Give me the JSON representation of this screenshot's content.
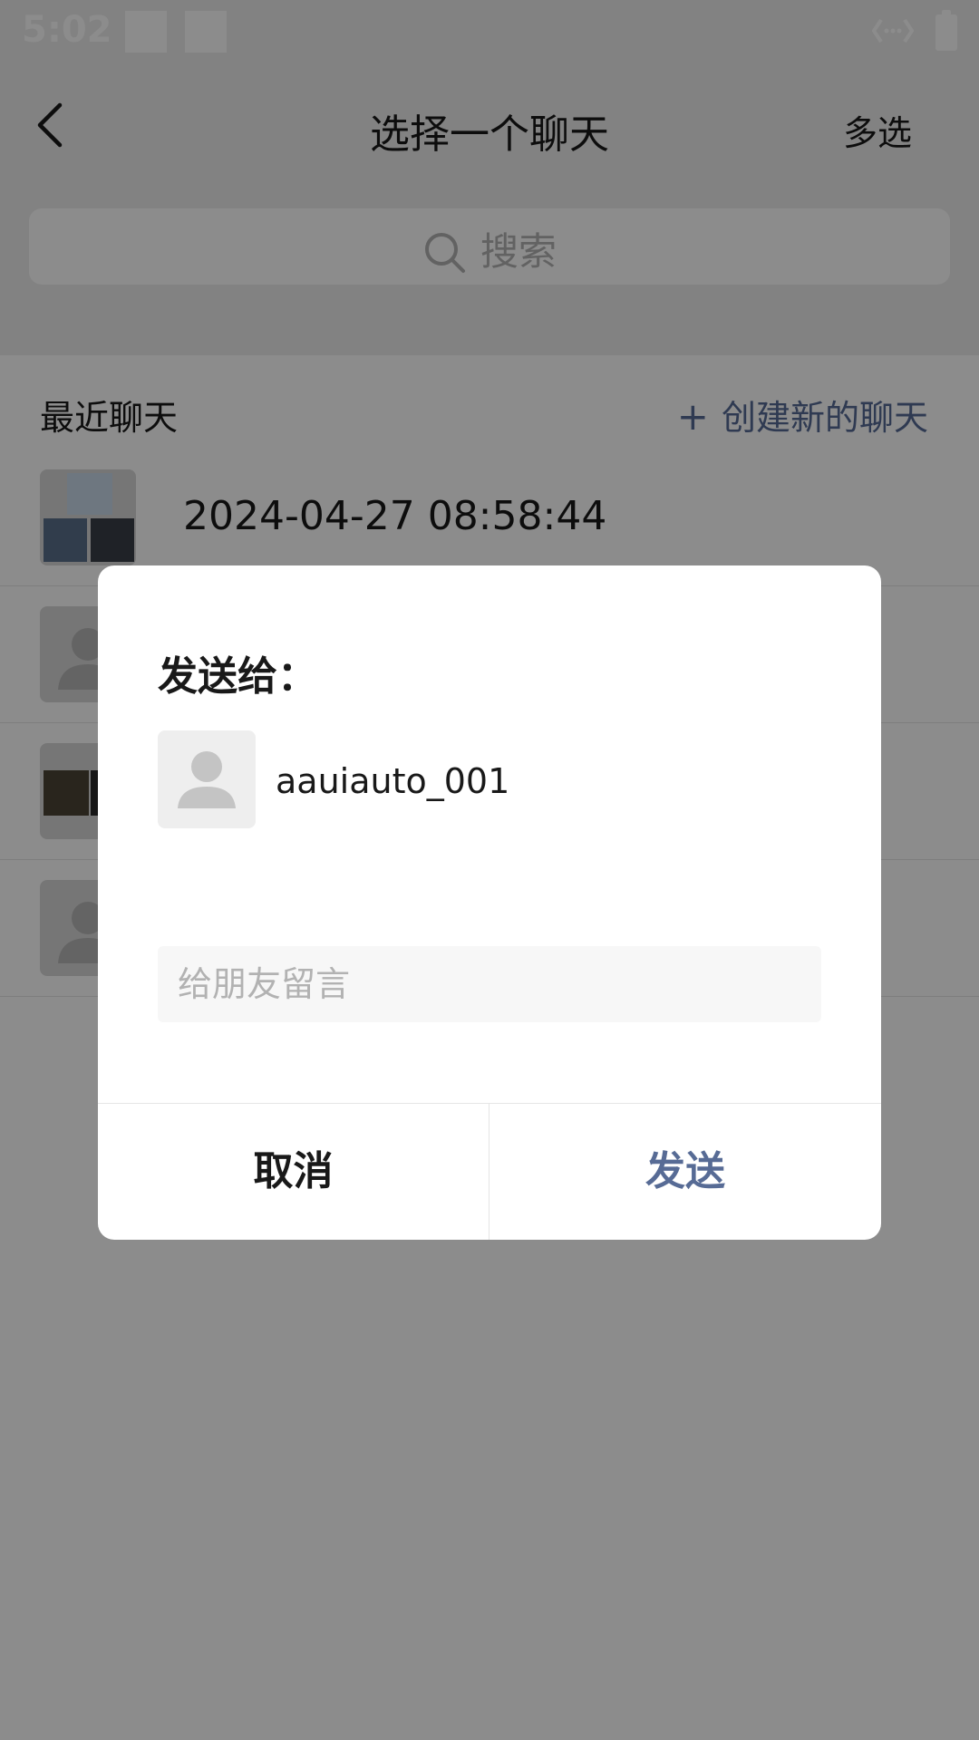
{
  "status_bar": {
    "time": "5:02"
  },
  "nav": {
    "title": "选择一个聊天",
    "multi_select": "多选"
  },
  "search": {
    "placeholder": "搜索"
  },
  "recent": {
    "label": "最近聊天",
    "create_icon": "+",
    "create_label": "创建新的聊天",
    "chats": [
      {
        "name": "2024-04-27 08:58:44",
        "avatar": "group-collage-avatar"
      },
      {
        "name": "",
        "avatar": "default-user-avatar"
      },
      {
        "name": "",
        "avatar": "group-photo-avatar"
      },
      {
        "name": "",
        "avatar": "default-user-avatar"
      }
    ]
  },
  "dialog": {
    "title": "发送给：",
    "recipient": {
      "name": "aauiauto_001",
      "avatar": "default-user-avatar"
    },
    "message_placeholder": "给朋友留言",
    "cancel_label": "取消",
    "send_label": "发送"
  },
  "colors": {
    "link": "#576b95",
    "text": "#191919",
    "placeholder": "#b2b2b2"
  }
}
